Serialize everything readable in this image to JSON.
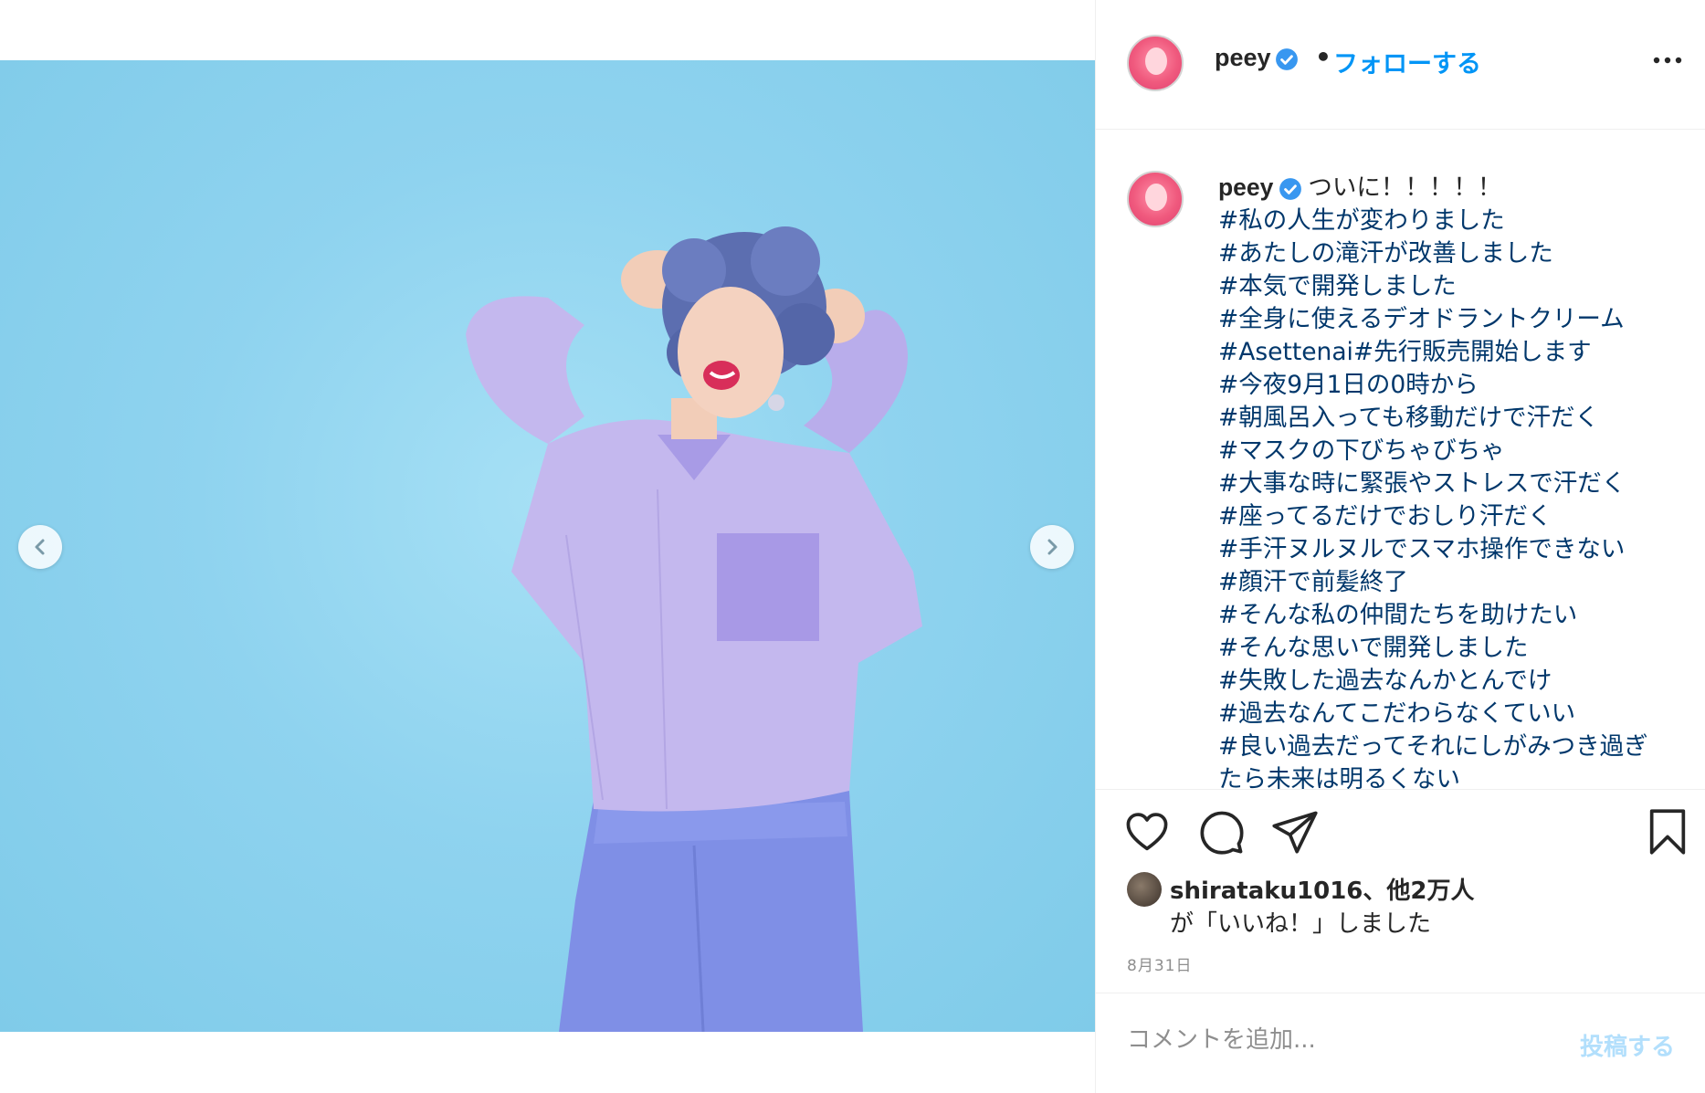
{
  "post": {
    "username": "peey",
    "follow_label": "フォローする",
    "dot": "•",
    "caption": {
      "first_line": "ついに！！！！！",
      "hashtags": [
        "#私の人生が変わりました",
        "#あたしの滝汗が改善しました",
        "#本気で開発しました",
        "#全身に使えるデオドラントクリーム",
        "#Asettenai#先行販売開始します",
        "#今夜9月1日の0時から",
        "#朝風呂入っても移動だけで汗だく",
        "#マスクの下びちゃびちゃ",
        "#大事な時に緊張やストレスで汗だく",
        "#座ってるだけでおしり汗だく",
        "#手汗ヌルヌルでスマホ操作できない",
        "#顔汗で前髪終了",
        "#そんな私の仲間たちを助けたい",
        "#そんな思いで開発しました",
        "#失敗した過去なんかとんでけ",
        "#過去なんてこだわらなくていい",
        "#良い過去だってそれにしがみつき過ぎ",
        "たら未来は明るくない"
      ]
    },
    "likes": {
      "line1": "shirataku1016、他2万人",
      "line2": "が「いいね！」しました"
    },
    "date": "8月31日",
    "comment": {
      "placeholder": "コメントを追加...",
      "post_label": "投稿する"
    }
  },
  "icons": {
    "verified": "verified-badge-icon",
    "more": "more-options-icon",
    "like": "heart-icon",
    "comment": "comment-icon",
    "share": "send-icon",
    "save": "bookmark-icon",
    "prev": "chevron-left-icon",
    "next": "chevron-right-icon"
  },
  "colors": {
    "link_blue": "#0095f6",
    "hashtag": "#00376b",
    "verified": "#3897f0",
    "post_disabled": "#b2dffc",
    "photo_bg": "#8fd3ef"
  }
}
